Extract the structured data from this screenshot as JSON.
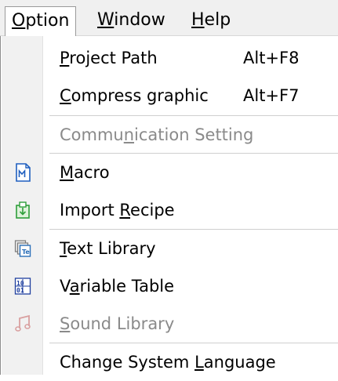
{
  "menubar": {
    "items": [
      {
        "label": "Option",
        "mnemonic": "O"
      },
      {
        "label": "Window",
        "mnemonic": "W"
      },
      {
        "label": "Help",
        "mnemonic": "H"
      }
    ]
  },
  "menu": {
    "items": [
      {
        "label_pre": "",
        "mnemonic": "P",
        "label_post": "roject Path",
        "shortcut": "Alt+F8",
        "enabled": true
      },
      {
        "label_pre": "",
        "mnemonic": "C",
        "label_post": "ompress graphic",
        "shortcut": "Alt+F7",
        "enabled": true
      },
      {
        "label_pre": "Commu",
        "mnemonic": "n",
        "label_post": "ication Setting",
        "shortcut": "",
        "enabled": false
      },
      {
        "label_pre": "",
        "mnemonic": "M",
        "label_post": "acro",
        "shortcut": "",
        "enabled": true,
        "icon": "macro-file-icon"
      },
      {
        "label_pre": "Import ",
        "mnemonic": "R",
        "label_post": "ecipe",
        "shortcut": "",
        "enabled": true,
        "icon": "import-recipe-icon"
      },
      {
        "label_pre": "",
        "mnemonic": "T",
        "label_post": "ext Library",
        "shortcut": "",
        "enabled": true,
        "icon": "text-library-icon"
      },
      {
        "label_pre": "V",
        "mnemonic": "a",
        "label_post": "riable Table",
        "shortcut": "",
        "enabled": true,
        "icon": "variable-table-icon"
      },
      {
        "label_pre": "",
        "mnemonic": "S",
        "label_post": "ound Library",
        "shortcut": "",
        "enabled": false,
        "icon": "music-note-icon"
      },
      {
        "label_pre": "Change System ",
        "mnemonic": "L",
        "label_post": "anguage",
        "shortcut": "",
        "enabled": true
      }
    ]
  },
  "colors": {
    "menubar_bg": "#f0f0f0",
    "gutter_bg": "#f1f1f1",
    "disabled_text": "#8a8a8a",
    "macro_icon": "#1f5fbf",
    "recipe_icon": "#2e9e3a",
    "sound_icon": "#d9a0a0"
  }
}
